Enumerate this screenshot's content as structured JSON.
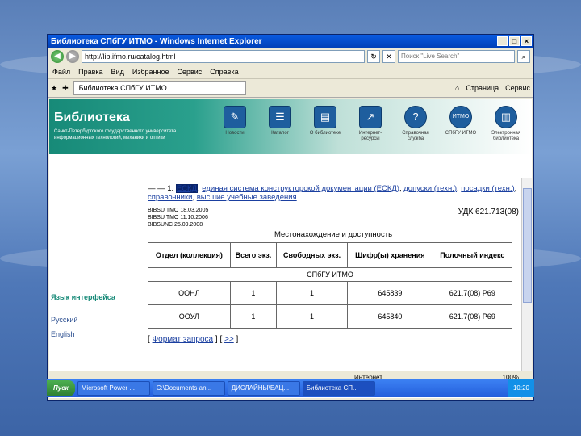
{
  "window": {
    "title": "Библиотека СПбГУ ИТМО - Windows Internet Explorer"
  },
  "address": {
    "url": "http://lib.ifmo.ru/catalog.html",
    "search_placeholder": "Поиск \"Live Search\""
  },
  "menu": [
    "Файл",
    "Правка",
    "Вид",
    "Избранное",
    "Сервис",
    "Справка"
  ],
  "tab": {
    "label": "Библиотека СПбГУ ИТМО"
  },
  "tools": [
    "Страница",
    "Сервис"
  ],
  "banner": {
    "title": "Библиотека",
    "subtitle": "Санкт-Петербургского государственного университета информационных технологий, механики и оптики"
  },
  "nav_icons": [
    {
      "label": "Новости"
    },
    {
      "label": "Каталог"
    },
    {
      "label": "О библиотеке"
    },
    {
      "label": "Интернет-ресурсы"
    },
    {
      "label": "Справочная служба"
    },
    {
      "label": "СПбГУ ИТМО"
    },
    {
      "label": "Электронная библиотека"
    }
  ],
  "sidebar": {
    "heading": "Язык интерфейса",
    "lang_ru": "Русский",
    "lang_en": "English"
  },
  "record": {
    "prefix": "— — 1.",
    "eskd": "ЕСКД",
    "subject_link": "единая система конструкторской документации (ЕСКД)",
    "sep": ",",
    "links": [
      "допуски (техн.)",
      "посадки (техн.)",
      "справочники",
      "высшие учебные заведения"
    ],
    "dates": [
      "BIBSU TMO 18.03.2005",
      "BIBSU TMO 11.10.2006",
      "BIBSUNC 25.09.2008"
    ],
    "udk": "УДК 621.713(08)",
    "location_title": "Местонахождение и доступность"
  },
  "table": {
    "headers": [
      "Отдел (коллекция)",
      "Всего экз.",
      "Свободных экз.",
      "Шифр(ы) хранения",
      "Полочный индекс"
    ],
    "library": "СПбГУ ИТМО",
    "rows": [
      [
        "ООНЛ",
        "1",
        "1",
        "645839",
        "621.7(08) Р69"
      ],
      [
        "ООУЛ",
        "1",
        "1",
        "645840",
        "621.7(08) Р69"
      ]
    ]
  },
  "form_links": {
    "format": "Формат запроса",
    "next": ">>"
  },
  "status": {
    "zone": "Интернет",
    "zoom": "100%"
  },
  "taskbar": {
    "start": "Пуск",
    "items": [
      "Microsoft Power ...",
      "C:\\Documents an...",
      "ДИСЛАЙНЫ\\ЕАЦ...",
      "Библиотека СП..."
    ],
    "clock": "10:20"
  }
}
